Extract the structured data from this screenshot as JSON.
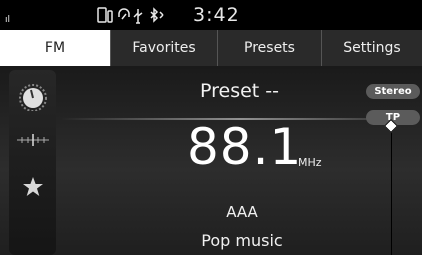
{
  "status": {
    "signal_mark": "ıl",
    "icons": [
      "phone-icon",
      "bluetooth-audio-icon",
      "usb-icon",
      "bluetooth-icon"
    ],
    "time": "3:42"
  },
  "tabs": [
    {
      "label": "FM",
      "active": true
    },
    {
      "label": "Favorites",
      "active": false
    },
    {
      "label": "Presets",
      "active": false
    },
    {
      "label": "Settings",
      "active": false
    }
  ],
  "side_icons": [
    "tune-dial-icon",
    "seek-scale-icon",
    "favorite-star-icon"
  ],
  "radio": {
    "preset": "Preset --",
    "frequency": "88.1",
    "unit": "MHz",
    "station": "AAA",
    "genre": "Pop music"
  },
  "badges": {
    "stereo": "Stereo",
    "tp": "TP"
  },
  "colors": {
    "background": "#1b1b1b",
    "active_tab": "#ffffff",
    "badge": "#5b5b5b"
  }
}
